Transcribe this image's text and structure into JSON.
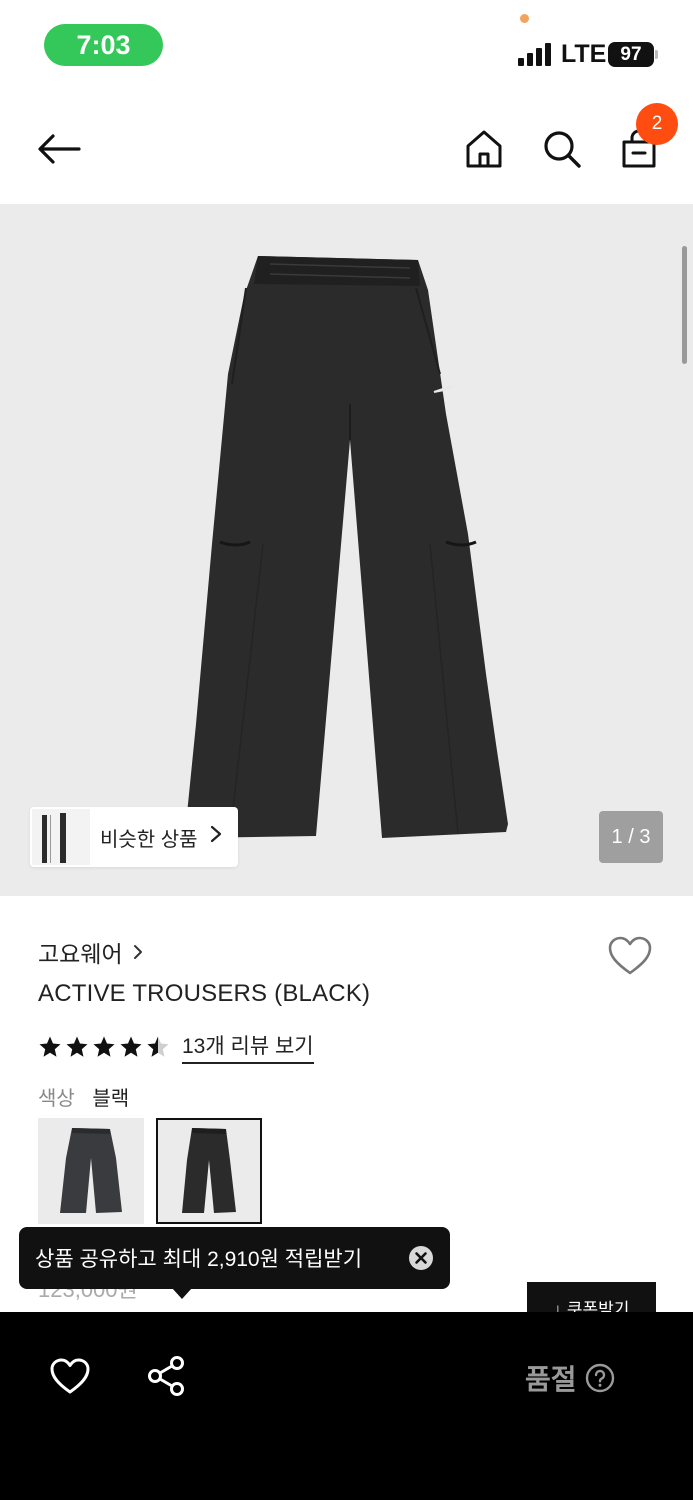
{
  "status_bar": {
    "time": "7:03",
    "network": "LTE",
    "battery": "97"
  },
  "header": {
    "cart_count": "2"
  },
  "gallery": {
    "similar_label": "비슷한 상품",
    "counter": "1 / 3"
  },
  "product": {
    "brand": "고요웨어",
    "title": "ACTIVE TROUSERS (BLACK)",
    "rating": 4.5,
    "review_link": "13개 리뷰 보기",
    "color_label": "색상",
    "color_value": "블랙",
    "price_partial": "123,000원"
  },
  "coupon": {
    "label": "↓ 쿠폰받기"
  },
  "tooltip": {
    "text": "상품 공유하고 최대 2,910원 적립받기"
  },
  "bottom_bar": {
    "status": "품절"
  },
  "colors": {
    "status_green": "#34c759",
    "badge_orange": "#ff4d12",
    "image_bg": "#ebebeb",
    "soldout_gray": "#9a9a9a"
  }
}
